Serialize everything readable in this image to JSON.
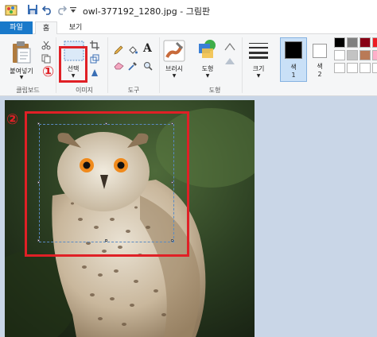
{
  "window": {
    "title": "owl-377192_1280.jpg - 그림판"
  },
  "tabs": {
    "file": "파일",
    "home": "홈",
    "view": "보기"
  },
  "ribbon": {
    "clipboard": {
      "paste_label": "붙여넣기",
      "group_label": "클립보드"
    },
    "image": {
      "select_label": "선택",
      "group_label": "이미지"
    },
    "tools": {
      "group_label": "도구",
      "text_glyph": "A"
    },
    "brushes": {
      "label": "브러시"
    },
    "shapes": {
      "label": "도형",
      "group_label": "도형"
    },
    "size": {
      "label": "크기"
    },
    "color1": {
      "label": "색\n1",
      "line1": "색",
      "line2": "1"
    },
    "color2": {
      "line1": "색",
      "line2": "2"
    }
  },
  "colors": {
    "accent": "#1979ca",
    "highlight_box": "#e02026",
    "color1": "#000000",
    "color2": "#ffffff",
    "palette": [
      "#000000",
      "#7f7f7f",
      "#880015",
      "#ed1c24",
      "#ffffff",
      "#c3c3c3",
      "#b97a57",
      "#ffaec9",
      "#ffffff",
      "#ffffff",
      "#ffffff",
      "#ffffff"
    ]
  },
  "annotations": {
    "step1": "①",
    "step2": "②"
  }
}
